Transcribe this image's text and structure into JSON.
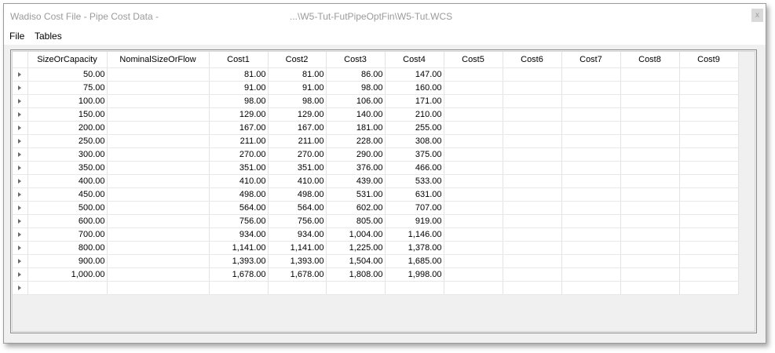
{
  "window": {
    "title": "Wadiso Cost File - Pipe Cost Data -",
    "path": "...\\W5-Tut-FutPipeOptFin\\W5-Tut.WCS",
    "close_label": "x"
  },
  "menu": {
    "file": "File",
    "tables": "Tables"
  },
  "grid": {
    "headers": [
      "SizeOrCapacity",
      "NominalSizeOrFlow",
      "Cost1",
      "Cost2",
      "Cost3",
      "Cost4",
      "Cost5",
      "Cost6",
      "Cost7",
      "Cost8",
      "Cost9"
    ],
    "rows": [
      [
        "50.00",
        "",
        "81.00",
        "81.00",
        "86.00",
        "147.00",
        "",
        "",
        "",
        "",
        ""
      ],
      [
        "75.00",
        "",
        "91.00",
        "91.00",
        "98.00",
        "160.00",
        "",
        "",
        "",
        "",
        ""
      ],
      [
        "100.00",
        "",
        "98.00",
        "98.00",
        "106.00",
        "171.00",
        "",
        "",
        "",
        "",
        ""
      ],
      [
        "150.00",
        "",
        "129.00",
        "129.00",
        "140.00",
        "210.00",
        "",
        "",
        "",
        "",
        ""
      ],
      [
        "200.00",
        "",
        "167.00",
        "167.00",
        "181.00",
        "255.00",
        "",
        "",
        "",
        "",
        ""
      ],
      [
        "250.00",
        "",
        "211.00",
        "211.00",
        "228.00",
        "308.00",
        "",
        "",
        "",
        "",
        ""
      ],
      [
        "300.00",
        "",
        "270.00",
        "270.00",
        "290.00",
        "375.00",
        "",
        "",
        "",
        "",
        ""
      ],
      [
        "350.00",
        "",
        "351.00",
        "351.00",
        "376.00",
        "466.00",
        "",
        "",
        "",
        "",
        ""
      ],
      [
        "400.00",
        "",
        "410.00",
        "410.00",
        "439.00",
        "533.00",
        "",
        "",
        "",
        "",
        ""
      ],
      [
        "450.00",
        "",
        "498.00",
        "498.00",
        "531.00",
        "631.00",
        "",
        "",
        "",
        "",
        ""
      ],
      [
        "500.00",
        "",
        "564.00",
        "564.00",
        "602.00",
        "707.00",
        "",
        "",
        "",
        "",
        ""
      ],
      [
        "600.00",
        "",
        "756.00",
        "756.00",
        "805.00",
        "919.00",
        "",
        "",
        "",
        "",
        ""
      ],
      [
        "700.00",
        "",
        "934.00",
        "934.00",
        "1,004.00",
        "1,146.00",
        "",
        "",
        "",
        "",
        ""
      ],
      [
        "800.00",
        "",
        "1,141.00",
        "1,141.00",
        "1,225.00",
        "1,378.00",
        "",
        "",
        "",
        "",
        ""
      ],
      [
        "900.00",
        "",
        "1,393.00",
        "1,393.00",
        "1,504.00",
        "1,685.00",
        "",
        "",
        "",
        "",
        ""
      ],
      [
        "1,000.00",
        "",
        "1,678.00",
        "1,678.00",
        "1,808.00",
        "1,998.00",
        "",
        "",
        "",
        "",
        ""
      ],
      [
        "",
        "",
        "",
        "",
        "",
        "",
        "",
        "",
        "",
        "",
        ""
      ]
    ]
  }
}
